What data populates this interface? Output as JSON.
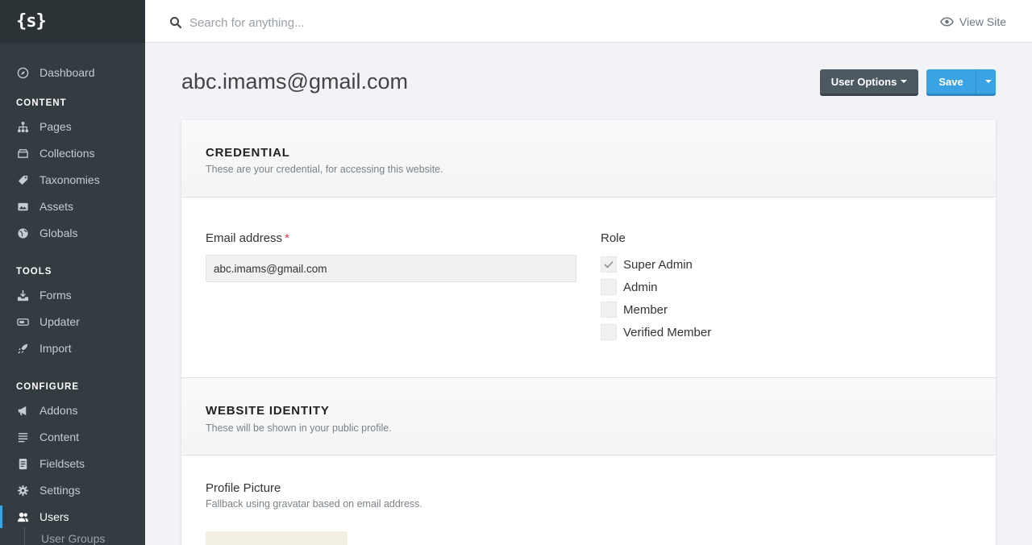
{
  "app": {
    "logo": "{s}"
  },
  "sidebar": {
    "dashboard": "Dashboard",
    "content_heading": "CONTENT",
    "content_items": [
      "Pages",
      "Collections",
      "Taxonomies",
      "Assets",
      "Globals"
    ],
    "tools_heading": "TOOLS",
    "tools_items": [
      "Forms",
      "Updater",
      "Import"
    ],
    "configure_heading": "CONFIGURE",
    "configure_items": [
      "Addons",
      "Content",
      "Fieldsets",
      "Settings",
      "Users"
    ],
    "sub_item": "User Groups",
    "active_item": "Users"
  },
  "topbar": {
    "search_placeholder": "Search for anything...",
    "view_site": "View Site"
  },
  "page": {
    "title": "abc.imams@gmail.com",
    "user_options": "User Options",
    "save": "Save"
  },
  "credential": {
    "title": "CREDENTIAL",
    "description": "These are your credential, for accessing this website.",
    "email_label": "Email address",
    "required_mark": "*",
    "email_value": "abc.imams@gmail.com",
    "role_label": "Role",
    "roles": [
      {
        "label": "Super Admin",
        "checked": true
      },
      {
        "label": "Admin",
        "checked": false
      },
      {
        "label": "Member",
        "checked": false
      },
      {
        "label": "Verified Member",
        "checked": false
      }
    ]
  },
  "identity": {
    "title": "WEBSITE IDENTITY",
    "description": "These will be shown in your public profile.",
    "picture_label": "Profile Picture",
    "picture_help": "Fallback using gravatar based on email address."
  },
  "colors": {
    "sidebar": "#333c41",
    "accent": "#3aa3e3",
    "options_button": "#4d5961"
  }
}
